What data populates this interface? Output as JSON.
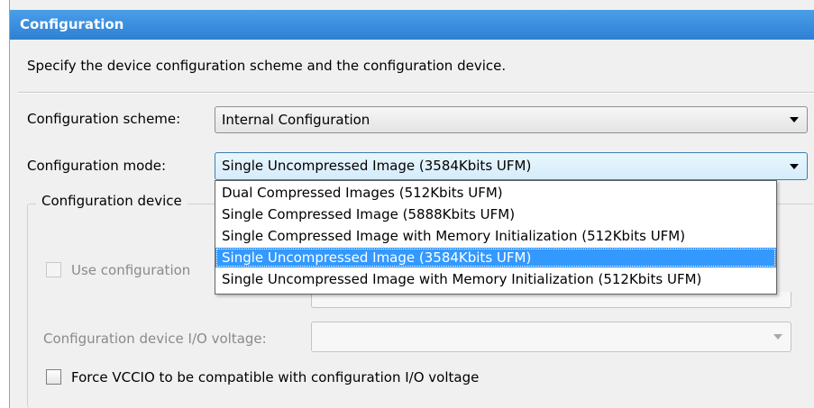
{
  "header": {
    "title": "Configuration"
  },
  "description": "Specify the device configuration scheme and the configuration device.",
  "config_scheme": {
    "label": "Configuration scheme:",
    "value": "Internal Configuration",
    "icon": "chevron-down-icon"
  },
  "config_mode": {
    "label": "Configuration mode:",
    "value": "Single Uncompressed Image (3584Kbits UFM)",
    "icon": "chevron-down-icon",
    "options": [
      "Dual Compressed Images (512Kbits UFM)",
      "Single Compressed Image (5888Kbits UFM)",
      "Single Compressed Image with Memory Initialization (512Kbits UFM)",
      "Single Uncompressed Image (3584Kbits UFM)",
      "Single Uncompressed Image with Memory Initialization (512Kbits UFM)"
    ],
    "selected_index": 3
  },
  "config_device_group": {
    "title": "Configuration device",
    "use_config_device_label": "Use configuration",
    "use_config_device_checked": false,
    "io_voltage_label": "Configuration device I/O voltage:",
    "io_voltage_value": "",
    "force_vccio_label": "Force VCCIO to be compatible with configuration I/O voltage",
    "force_vccio_checked": false
  },
  "colors": {
    "header_bg": "#2e80d4",
    "selection_bg": "#3399ff",
    "disabled_text": "#8a8a8a"
  }
}
